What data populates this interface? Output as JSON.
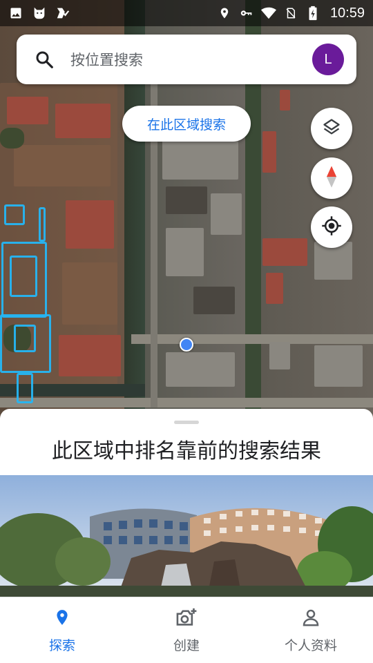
{
  "status_bar": {
    "time": "10:59",
    "left_icons": [
      "image-icon",
      "cat-icon",
      "check-icon"
    ],
    "right_icons": [
      "location-pin-icon",
      "key-icon",
      "wifi-icon",
      "no-sim-icon",
      "battery-charging-icon"
    ]
  },
  "search": {
    "placeholder": "按位置搜索",
    "avatar_letter": "L",
    "avatar_color": "#6a1b9a"
  },
  "map": {
    "search_area_label": "在此区域搜索",
    "buttons": [
      "layers-icon",
      "compass-icon",
      "my-location-icon"
    ],
    "route_color": "#25b6f4",
    "location_dot_color": "#4285f4"
  },
  "sheet": {
    "title": "此区域中排名靠前的搜索结果"
  },
  "bottom_nav": {
    "items": [
      {
        "label": "探索",
        "icon": "explore-pin-icon",
        "active": true
      },
      {
        "label": "创建",
        "icon": "add-photo-icon",
        "active": false
      },
      {
        "label": "个人资料",
        "icon": "profile-icon",
        "active": false
      }
    ],
    "accent": "#1a73e8"
  }
}
